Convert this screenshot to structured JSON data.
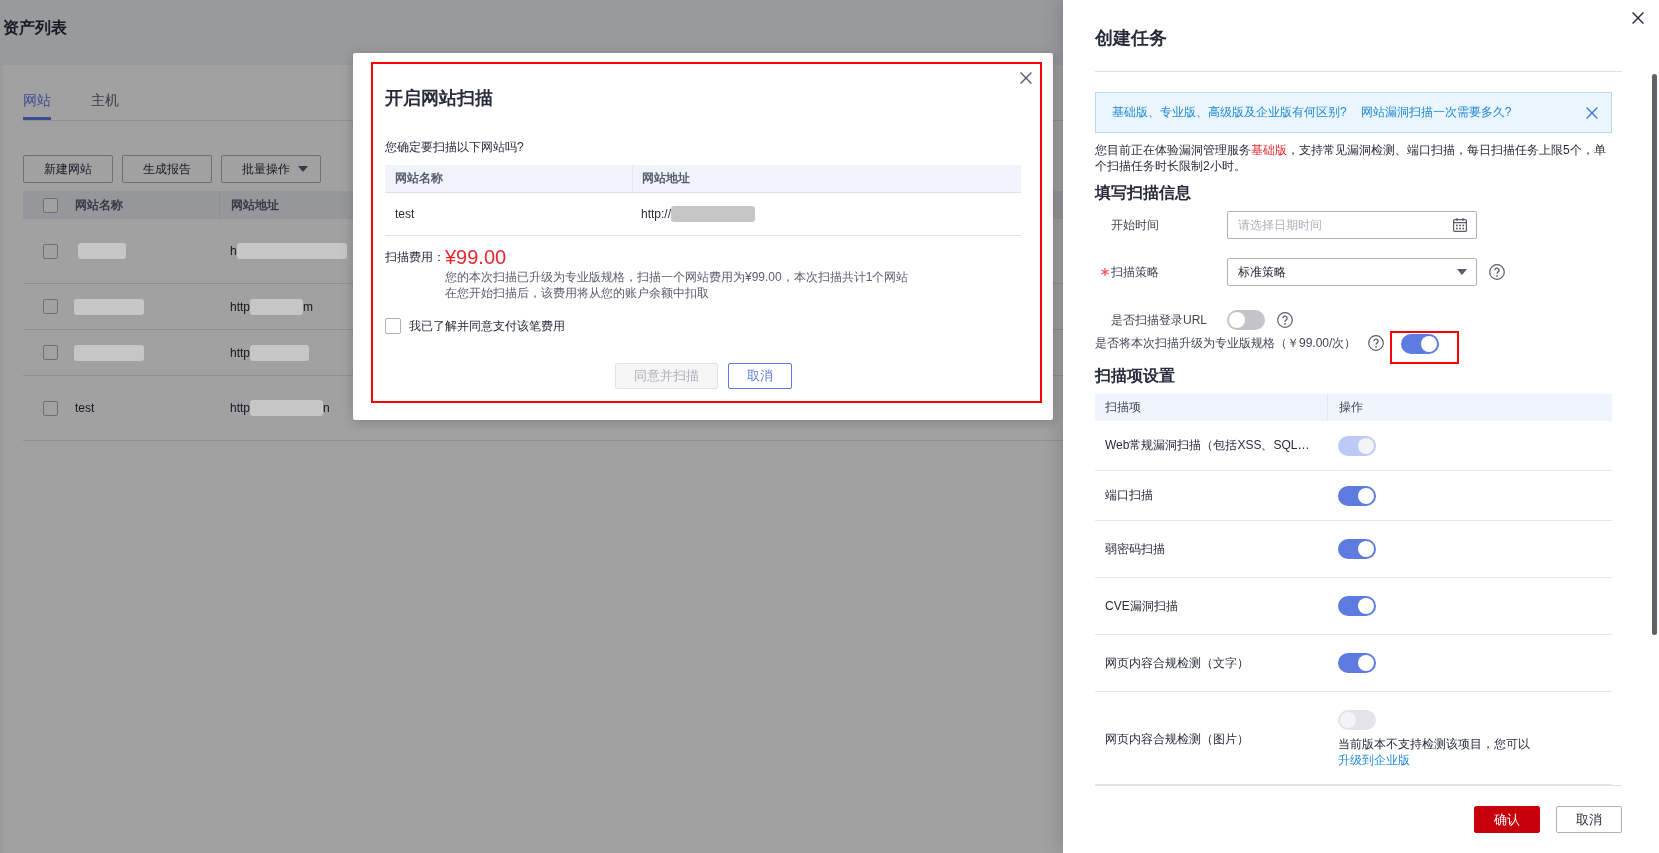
{
  "page": {
    "title": "资产列表",
    "tabs": [
      {
        "label": "网站",
        "selected": true
      },
      {
        "label": "主机",
        "selected": false
      }
    ],
    "toolbar": [
      {
        "label": "新建网站",
        "kind": "button"
      },
      {
        "label": "生成报告",
        "kind": "button"
      },
      {
        "label": "批量操作",
        "kind": "dropdown"
      }
    ],
    "table": {
      "select_all_checked": false,
      "columns": [
        "网站名称",
        "网站地址"
      ],
      "rows": [
        {
          "checked": false,
          "name_redacted": true,
          "address_prefix": "h",
          "address_redacted": true
        },
        {
          "checked": false,
          "name_redacted": true,
          "address_prefix": "http",
          "address_redacted": true,
          "address_suffix": "m"
        },
        {
          "checked": false,
          "name_redacted": true,
          "address_prefix": "http",
          "address_redacted": true
        },
        {
          "checked": false,
          "name": "test",
          "address_prefix": "http",
          "address_redacted": true,
          "address_suffix": "n"
        }
      ]
    }
  },
  "modal": {
    "highlighted": true,
    "title": "开启网站扫描",
    "question": "您确定要扫描以下网站吗?",
    "table": {
      "columns": [
        "网站名称",
        "网站地址"
      ],
      "rows": [
        {
          "name": "test",
          "address_prefix": "http://",
          "address_redacted": true
        }
      ]
    },
    "fee_label": "扫描费用：",
    "fee": "¥99.00",
    "fee_notes": [
      "您的本次扫描已升级为专业版规格，扫描一个网站费用为¥99.00，本次扫描共计1个网站",
      "在您开始扫描后，该费用将从您的账户余额中扣取"
    ],
    "agree": {
      "label": "我已了解并同意支付该笔费用",
      "checked": false
    },
    "buttons": [
      {
        "label": "同意并扫描",
        "kind": "primary",
        "disabled": true
      },
      {
        "label": "取消",
        "kind": "secondary",
        "disabled": false
      }
    ]
  },
  "drawer": {
    "title": "创建任务",
    "notice": {
      "links": [
        "基础版、专业版、高级版及企业版有何区别?",
        "网站漏洞扫描一次需要多久?"
      ]
    },
    "intro": "您目前正在体验漏洞管理服务**基础版**，支持常见漏洞检测、端口扫描，每日扫描任务上限5个，单个扫描任务时长限制2小时。",
    "form_title": "填写扫描信息",
    "fields": [
      {
        "kind": "datetime",
        "label": "开始时间",
        "placeholder": "请选择日期时间"
      },
      {
        "kind": "select",
        "label": "扫描策略",
        "required": true,
        "value": "标准策略",
        "help": true
      },
      {
        "kind": "switch",
        "label": "是否扫描登录URL",
        "on": false,
        "help": true
      },
      {
        "kind": "inline_switch",
        "label": "是否将本次扫描升级为专业版规格（￥99.00/次）",
        "on": true,
        "help": true,
        "highlighted": true
      }
    ],
    "items_title": "扫描项设置",
    "scan_items": {
      "columns": [
        "扫描项",
        "操作"
      ],
      "rows": [
        {
          "label": "Web常规漏洞扫描（包括XSS、SQL…",
          "on": true,
          "disabled": true
        },
        {
          "label": "端口扫描",
          "on": true,
          "disabled": false
        },
        {
          "label": "弱密码扫描",
          "on": true,
          "disabled": false
        },
        {
          "label": "CVE漏洞扫描",
          "on": true,
          "disabled": false
        },
        {
          "label": "网页内容合规检测（文字）",
          "on": true,
          "disabled": false
        },
        {
          "label": "网页内容合规检测（图片）",
          "on": false,
          "disabled": true,
          "note": "当前版本不支持检测该项目，您可以",
          "link": "升级到企业版"
        }
      ]
    },
    "buttons": [
      {
        "label": "确认",
        "kind": "primary"
      },
      {
        "label": "取消",
        "kind": "secondary"
      }
    ]
  }
}
